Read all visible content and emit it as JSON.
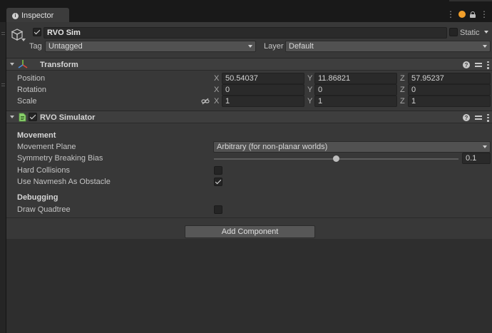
{
  "window": {
    "tab_label": "Inspector"
  },
  "gameobject": {
    "name": "RVO Sim",
    "active": true,
    "static_label": "Static",
    "tag_label": "Tag",
    "tag_value": "Untagged",
    "layer_label": "Layer",
    "layer_value": "Default"
  },
  "transform": {
    "title": "Transform",
    "position": {
      "label": "Position",
      "x": "50.54037",
      "y": "11.86821",
      "z": "57.95237"
    },
    "rotation": {
      "label": "Rotation",
      "x": "0",
      "y": "0",
      "z": "0"
    },
    "scale": {
      "label": "Scale",
      "x": "1",
      "y": "1",
      "z": "1"
    },
    "axis_x": "X",
    "axis_y": "Y",
    "axis_z": "Z"
  },
  "rvo": {
    "title": "RVO Simulator",
    "enabled": true,
    "movement_header": "Movement",
    "movement_plane_label": "Movement Plane",
    "movement_plane_value": "Arbitrary (for non-planar worlds)",
    "symmetry_label": "Symmetry Breaking Bias",
    "symmetry_value": "0.1",
    "symmetry_fraction": 0.5,
    "hard_collisions_label": "Hard Collisions",
    "hard_collisions": false,
    "navmesh_label": "Use Navmesh As Obstacle",
    "navmesh": true,
    "debugging_header": "Debugging",
    "draw_quadtree_label": "Draw Quadtree",
    "draw_quadtree": false
  },
  "add_component_label": "Add Component",
  "colors": {
    "accent_orange": "#f29f2a",
    "panel": "#383838",
    "transform_icon_red": "#e04a3a",
    "transform_icon_green": "#7dc242",
    "transform_icon_blue": "#4a8fe0",
    "script_icon_green": "#8bd16d"
  },
  "icons": {
    "tab": "info-icon",
    "gameobject": "cube-icon",
    "transform": "transform-axes-icon",
    "script": "script-file-icon",
    "help": "help-icon",
    "presets": "sliders-icon",
    "menu": "kebab-icon",
    "scale_link": "link-icon"
  }
}
